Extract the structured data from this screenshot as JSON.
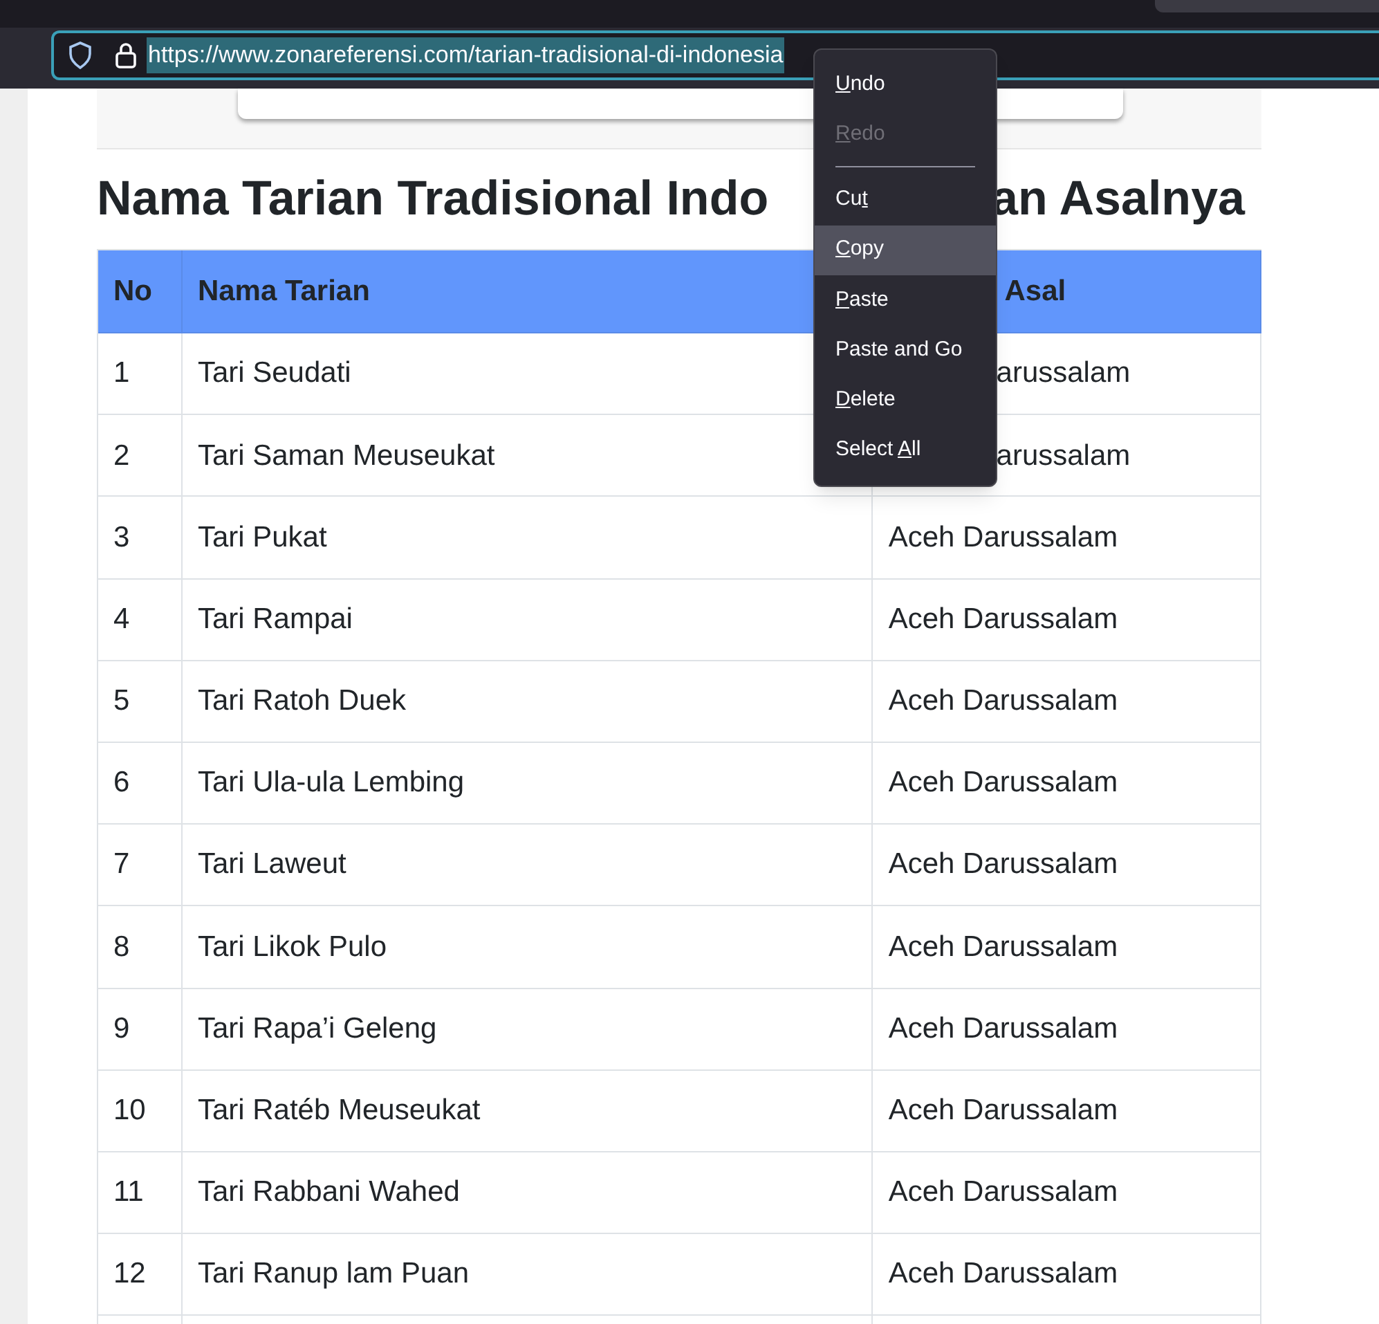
{
  "browser": {
    "url": "https://www.zonareferensi.com/tarian-tradisional-di-indonesia",
    "url_selected": true
  },
  "article": {
    "heading_parts": [
      "Nama Tarian Tradisional Indo",
      "an Asalnya"
    ],
    "table": {
      "columns": [
        {
          "label": "No",
          "covered": false
        },
        {
          "label": "Nama Tarian",
          "covered": false
        },
        {
          "label": "Asal",
          "covered": true
        }
      ],
      "rows": [
        {
          "no": "1",
          "name": "Tari Seudati",
          "origin": "arussalam",
          "origin_covered": true
        },
        {
          "no": "2",
          "name": "Tari Saman Meuseukat",
          "origin": "arussalam",
          "origin_covered": true
        },
        {
          "no": "3",
          "name": "Tari Pukat",
          "origin": "Aceh Darussalam",
          "origin_covered": false
        },
        {
          "no": "4",
          "name": "Tari Rampai",
          "origin": "Aceh Darussalam",
          "origin_covered": false
        },
        {
          "no": "5",
          "name": "Tari Ratoh Duek",
          "origin": "Aceh Darussalam",
          "origin_covered": false
        },
        {
          "no": "6",
          "name": "Tari Ula-ula Lembing",
          "origin": "Aceh Darussalam",
          "origin_covered": false
        },
        {
          "no": "7",
          "name": "Tari Laweut",
          "origin": "Aceh Darussalam",
          "origin_covered": false
        },
        {
          "no": "8",
          "name": "Tari Likok Pulo",
          "origin": "Aceh Darussalam",
          "origin_covered": false
        },
        {
          "no": "9",
          "name": "Tari Rapa’i Geleng",
          "origin": "Aceh Darussalam",
          "origin_covered": false
        },
        {
          "no": "10",
          "name": "Tari Ratéb Meuseukat",
          "origin": "Aceh Darussalam",
          "origin_covered": false
        },
        {
          "no": "11",
          "name": "Tari Rabbani Wahed",
          "origin": "Aceh Darussalam",
          "origin_covered": false
        },
        {
          "no": "12",
          "name": "Tari Ranup lam Puan",
          "origin": "Aceh Darussalam",
          "origin_covered": false
        }
      ]
    }
  },
  "context_menu": {
    "items": [
      {
        "kind": "item",
        "label": {
          "key": "U",
          "after": "ndo"
        },
        "disabled": false,
        "selected": false
      },
      {
        "kind": "item",
        "label": {
          "key": "R",
          "after": "edo"
        },
        "disabled": true,
        "selected": false
      },
      {
        "kind": "separator"
      },
      {
        "kind": "item",
        "label": {
          "before": "Cu",
          "key": "t"
        },
        "disabled": false,
        "selected": false
      },
      {
        "kind": "item",
        "label": {
          "key": "C",
          "after": "opy"
        },
        "disabled": false,
        "selected": true
      },
      {
        "kind": "item",
        "label": {
          "key": "P",
          "after": "aste"
        },
        "disabled": false,
        "selected": false
      },
      {
        "kind": "item",
        "label": {
          "before": "Paste and Go"
        },
        "disabled": false,
        "selected": false
      },
      {
        "kind": "item",
        "label": {
          "key": "D",
          "after": "elete"
        },
        "disabled": false,
        "selected": false
      },
      {
        "kind": "item",
        "label": {
          "before": "Select ",
          "key": "A",
          "after": "ll"
        },
        "disabled": false,
        "selected": false
      }
    ]
  }
}
